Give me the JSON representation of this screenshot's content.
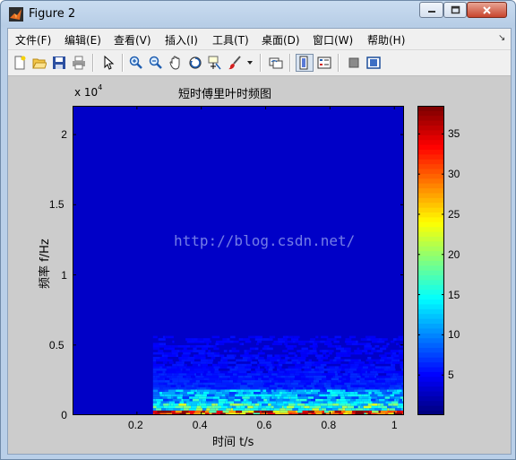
{
  "window": {
    "title": "Figure 2",
    "controls": [
      "minimize",
      "maximize",
      "close"
    ]
  },
  "menu": [
    "文件(F)",
    "编辑(E)",
    "查看(V)",
    "插入(I)",
    "工具(T)",
    "桌面(D)",
    "窗口(W)",
    "帮助(H)"
  ],
  "toolbar": {
    "icons": [
      "new-figure-icon",
      "open-file-icon",
      "save-icon",
      "print-icon",
      "edit-plot-arrow-icon",
      "zoom-in-icon",
      "zoom-out-icon",
      "pan-hand-icon",
      "rotate-3d-icon",
      "data-cursor-icon",
      "brush-icon",
      "brush-dropdown-icon",
      "link-plot-icon",
      "colorbar-icon",
      "legend-icon",
      "hide-plot-tools-icon",
      "show-plot-tools-icon"
    ]
  },
  "figure": {
    "title": "短时傅里叶时频图",
    "xlabel": "时间 t/s",
    "ylabel": "频率 f/Hz",
    "y_exponent": "x 10",
    "y_exponent_power": "4",
    "watermark": "http://blog.csdn.net/",
    "colors": {
      "background": "#cccccc",
      "spectrogram_bg": "#00008f"
    }
  },
  "chart_data": [
    {
      "type": "heatmap",
      "title": "短时傅里叶时频图",
      "xlabel": "时间 t/s",
      "ylabel": "频率 f/Hz",
      "xlim": [
        0,
        1.03
      ],
      "ylim": [
        0,
        22050
      ],
      "xticks": [
        "0.2",
        "0.4",
        "0.6",
        "0.8",
        "1"
      ],
      "yticks": [
        "0",
        "0.5",
        "1",
        "1.5",
        "2"
      ],
      "y_multiplier": "x 10^4",
      "colormap": "jet",
      "signal_onset_time": 0.25,
      "dominant_energy_band_hz": [
        0,
        5500
      ],
      "peak_band_hz": [
        0,
        300
      ]
    },
    {
      "type": "heatmap",
      "role": "colorbar",
      "range": [
        0,
        38.5
      ],
      "ticks": [
        "5",
        "10",
        "15",
        "20",
        "25",
        "30",
        "35"
      ]
    }
  ]
}
